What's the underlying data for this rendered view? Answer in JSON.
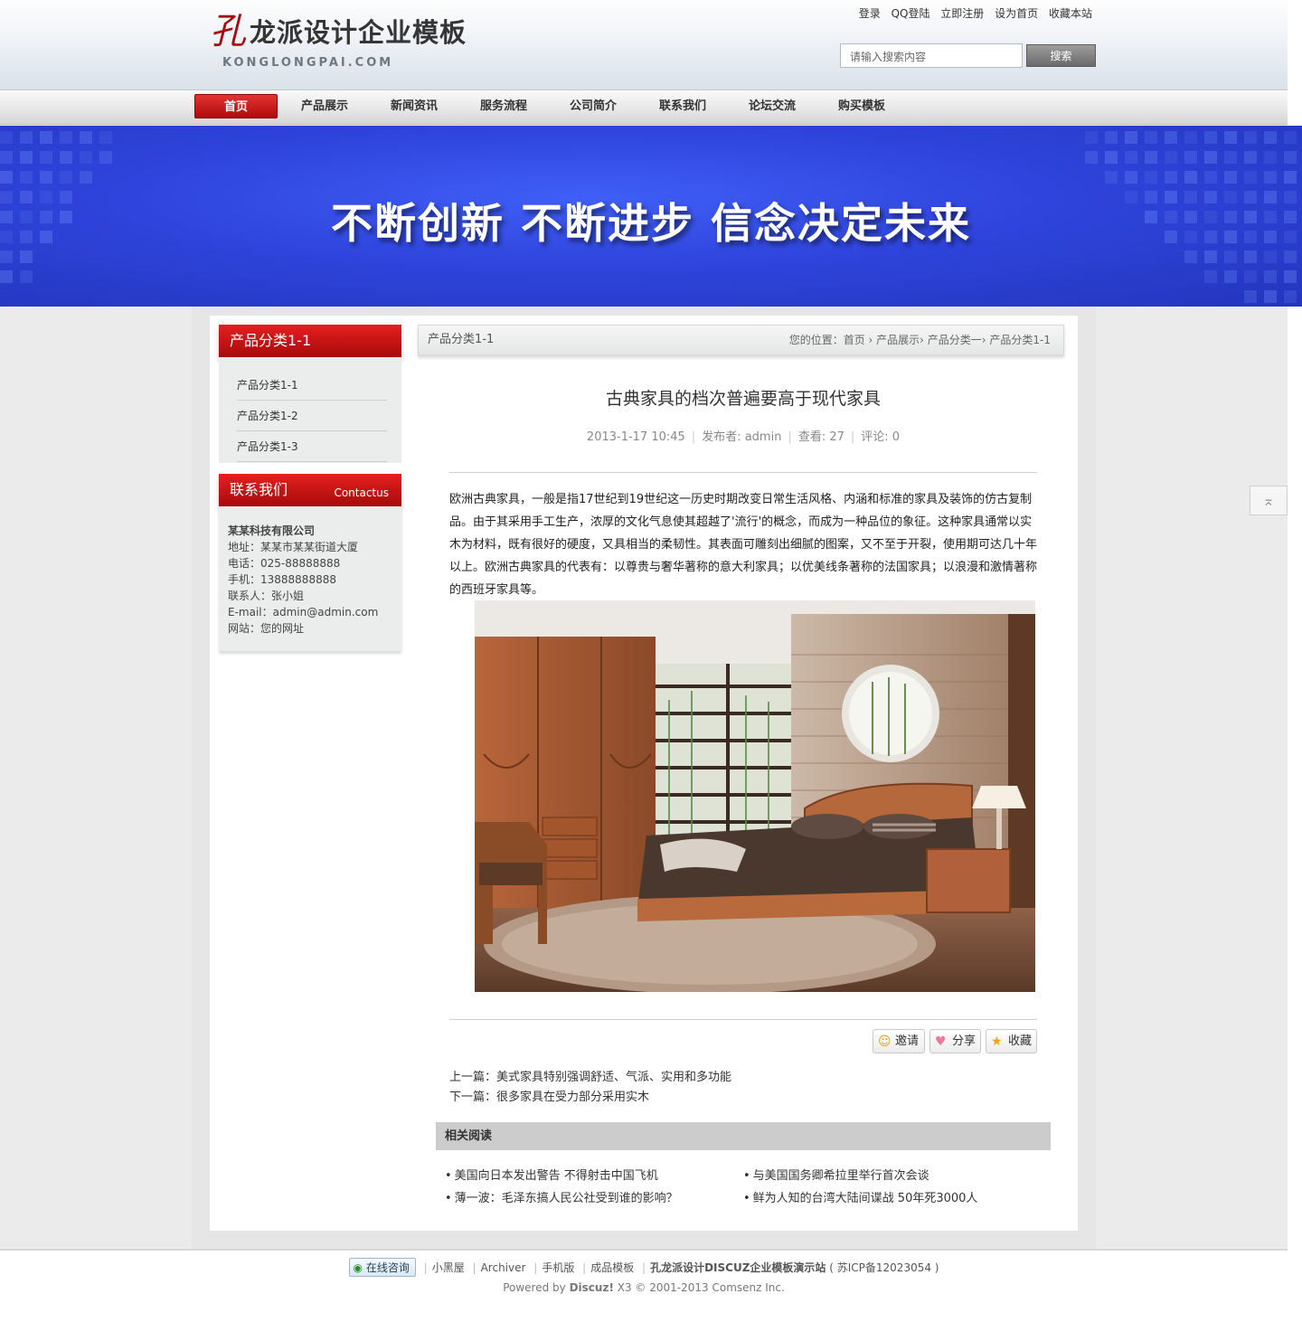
{
  "header": {
    "logo_mark": "孔",
    "logo_title": "龙派设计企业模板",
    "logo_sub": "KONGLONGPAI.COM",
    "toplinks": [
      "登录",
      "QQ登陆",
      "立即注册",
      "设为首页",
      "收藏本站"
    ],
    "search_placeholder": "请输入搜索内容",
    "search_button": "搜索"
  },
  "nav": {
    "items": [
      "首页",
      "产品展示",
      "新闻资讯",
      "服务流程",
      "公司简介",
      "联系我们",
      "论坛交流",
      "购买模板"
    ],
    "active_index": 0
  },
  "banner": {
    "text": "不断创新 不断进步 信念决定未来"
  },
  "sidebar": {
    "category_title": "产品分类1-1",
    "categories": [
      "产品分类1-1",
      "产品分类1-2",
      "产品分类1-3"
    ],
    "contact_title": "联系我们",
    "contact_title_en": "Contactus",
    "contact_lines": [
      "某某科技有限公司",
      "地址：某某市某某街道大厦",
      "电话：025-88888888",
      "手机：13888888888",
      "联系人：张小姐",
      "E-mail：admin@admin.com",
      "网站：您的网址"
    ]
  },
  "breadcrumb": {
    "title": "产品分类1-1",
    "path": "您的位置：首页 › 产品展示› 产品分类一› 产品分类1-1"
  },
  "article": {
    "title": "古典家具的档次普遍要高于现代家具",
    "date": "2013-1-17 10:45",
    "author": "发布者: admin",
    "views": "查看: 27",
    "comments": "评论: 0",
    "body": "欧洲古典家具，一般是指17世纪到19世纪这一历史时期改变日常生活风格、内涵和标准的家具及装饰的仿古复制品。由于其采用手工生产，浓厚的文化气息使其超越了'流行'的概念，而成为一种品位的象征。这种家具通常以实木为材料，既有很好的硬度，又具相当的柔韧性。其表面可雕刻出细腻的图案，又不至于开裂，使用期可达几十年以上。欧洲古典家具的代表有：以尊贵与奢华著称的意大利家具；以优美线条著称的法国家具；以浪漫和激情著称的西班牙家具等。",
    "share_buttons": [
      "邀请",
      "分享",
      "收藏"
    ],
    "prev": "上一篇：美式家具特别强调舒适、气派、实用和多功能",
    "next": "下一篇：很多家具在受力部分采用实木"
  },
  "related": {
    "title": "相关阅读",
    "items": [
      "美国向日本发出警告 不得射击中国飞机",
      "与美国国务卿希拉里举行首次会谈",
      "薄一波：毛泽东搞人民公社受到谁的影响？",
      "鲜为人知的台湾大陆间谍战 50年死3000人"
    ]
  },
  "footer": {
    "consult": "在线咨询",
    "links": [
      "小黑屋",
      "Archiver",
      "手机版",
      "成品模板"
    ],
    "site": "孔龙派设计DISCUZ企业模板演示站",
    "icp": "( 苏ICP备12023054 )",
    "powered_prefix": "Powered by",
    "powered_brand": "Discuz!",
    "powered_suffix": "X3 © 2001-2013 Comsenz Inc."
  },
  "colors": {
    "brand_red": "#c4100f",
    "banner_blue": "#3048e0"
  },
  "icons": {
    "totop": "arrow-up-icon",
    "invite": "people-icon",
    "share": "heart-icon",
    "fav": "star-icon"
  }
}
